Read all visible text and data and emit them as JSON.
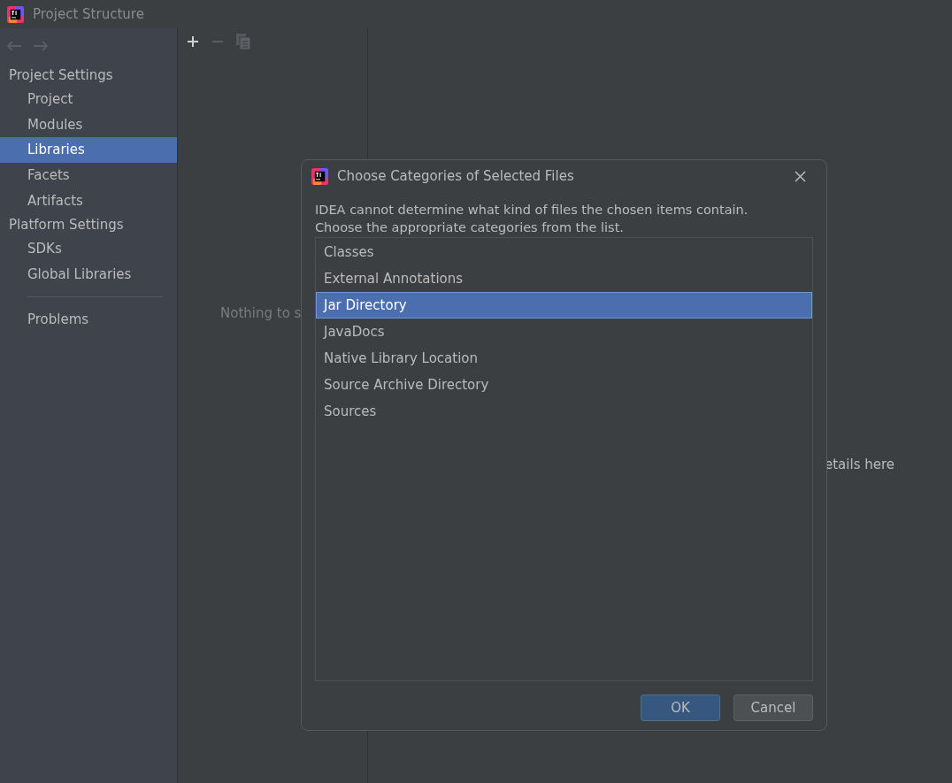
{
  "window": {
    "title": "Project Structure"
  },
  "sidebar": {
    "sections": [
      {
        "title": "Project Settings",
        "items": [
          {
            "label": "Project",
            "selected": false
          },
          {
            "label": "Modules",
            "selected": false
          },
          {
            "label": "Libraries",
            "selected": true
          },
          {
            "label": "Facets",
            "selected": false
          },
          {
            "label": "Artifacts",
            "selected": false
          }
        ]
      },
      {
        "title": "Platform Settings",
        "items": [
          {
            "label": "SDKs",
            "selected": false
          },
          {
            "label": "Global Libraries",
            "selected": false
          }
        ]
      }
    ],
    "bottom_items": [
      {
        "label": "Problems",
        "selected": false
      }
    ]
  },
  "middle_panel": {
    "empty_text": "Nothing to s"
  },
  "detail_panel": {
    "empty_text": "etails here"
  },
  "dialog": {
    "title": "Choose Categories of Selected Files",
    "message": [
      "IDEA cannot determine what kind of files the chosen items contain.",
      "Choose the appropriate categories from the list."
    ],
    "items": [
      {
        "label": "Classes",
        "selected": false
      },
      {
        "label": "External Annotations",
        "selected": false
      },
      {
        "label": "Jar Directory",
        "selected": true
      },
      {
        "label": "JavaDocs",
        "selected": false
      },
      {
        "label": "Native Library Location",
        "selected": false
      },
      {
        "label": "Source Archive Directory",
        "selected": false
      },
      {
        "label": "Sources",
        "selected": false
      }
    ],
    "buttons": [
      {
        "label": "OK",
        "kind": "primary"
      },
      {
        "label": "Cancel",
        "kind": "secondary"
      }
    ]
  }
}
